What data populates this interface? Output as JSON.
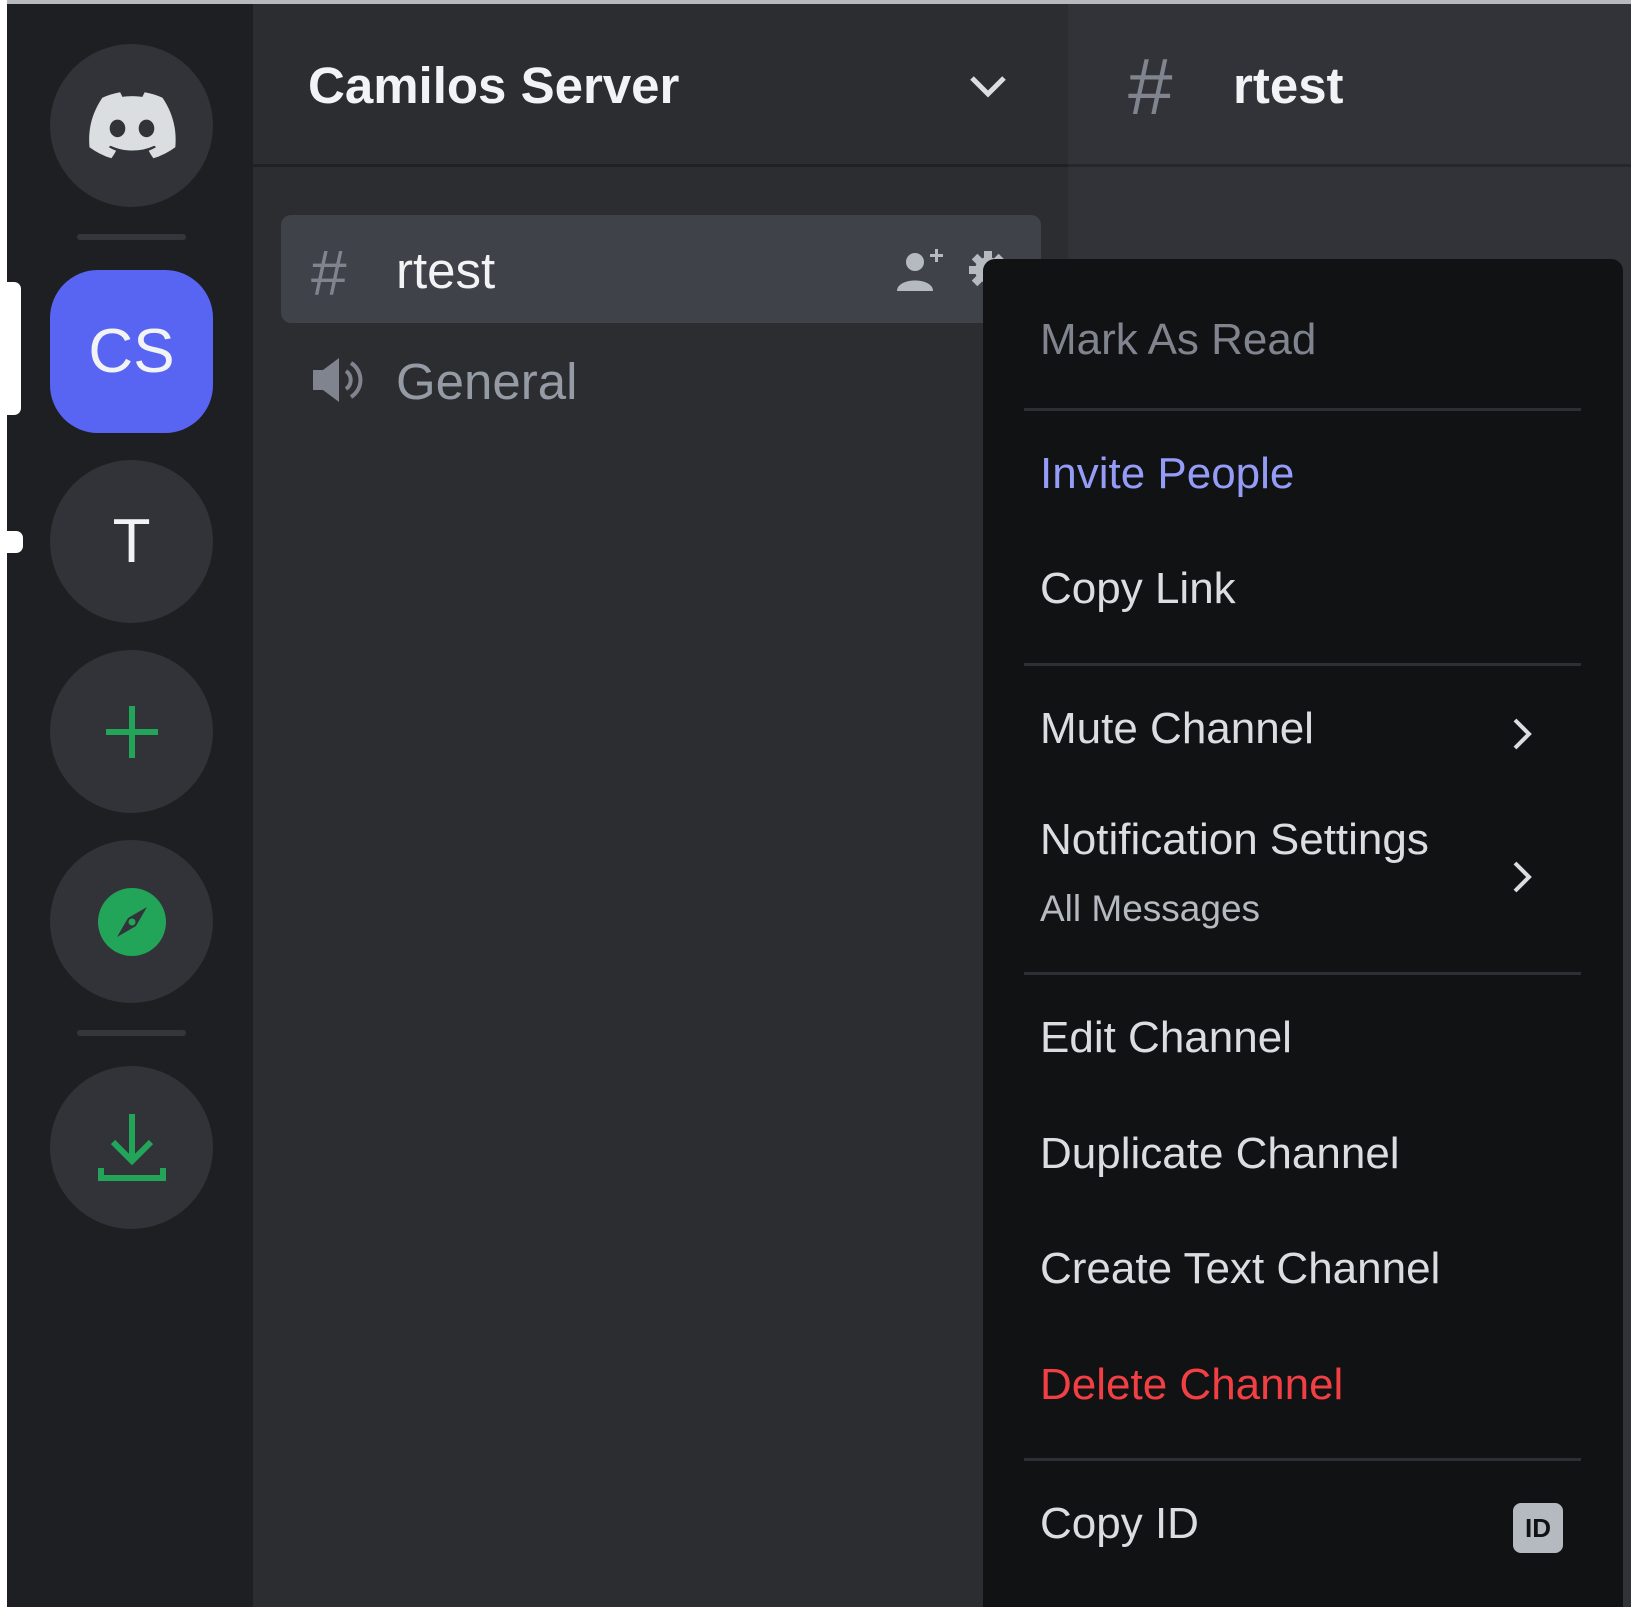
{
  "server_rail": {
    "items": [
      {
        "kind": "home",
        "icon": "discord-logo-icon"
      },
      {
        "kind": "server",
        "label": "CS",
        "active": true
      },
      {
        "kind": "server",
        "label": "T",
        "unread": true
      },
      {
        "kind": "action",
        "icon": "plus-icon"
      },
      {
        "kind": "action",
        "icon": "compass-icon"
      },
      {
        "kind": "action",
        "icon": "download-icon"
      }
    ]
  },
  "channel_list": {
    "server_name": "Camilos Server",
    "channels": [
      {
        "type": "text",
        "name": "rtest",
        "selected": true
      },
      {
        "type": "voice",
        "name": "General"
      }
    ]
  },
  "main_header": {
    "channel_name": "rtest"
  },
  "context_menu": {
    "mark_as_read": "Mark As Read",
    "invite_people": "Invite People",
    "copy_link": "Copy Link",
    "mute_channel": "Mute Channel",
    "notification_settings": "Notification Settings",
    "notification_value": "All Messages",
    "edit_channel": "Edit Channel",
    "duplicate_channel": "Duplicate Channel",
    "create_text_channel": "Create Text Channel",
    "delete_channel": "Delete Channel",
    "copy_id": "Copy ID",
    "id_badge": "ID"
  },
  "colors": {
    "rail_bg": "#1e1f22",
    "channels_bg": "#2b2d31",
    "main_bg": "#313338",
    "menu_bg": "#111214",
    "brand": "#5865f2",
    "green": "#23a559",
    "danger": "#f23f43",
    "invite": "#949cf7"
  }
}
